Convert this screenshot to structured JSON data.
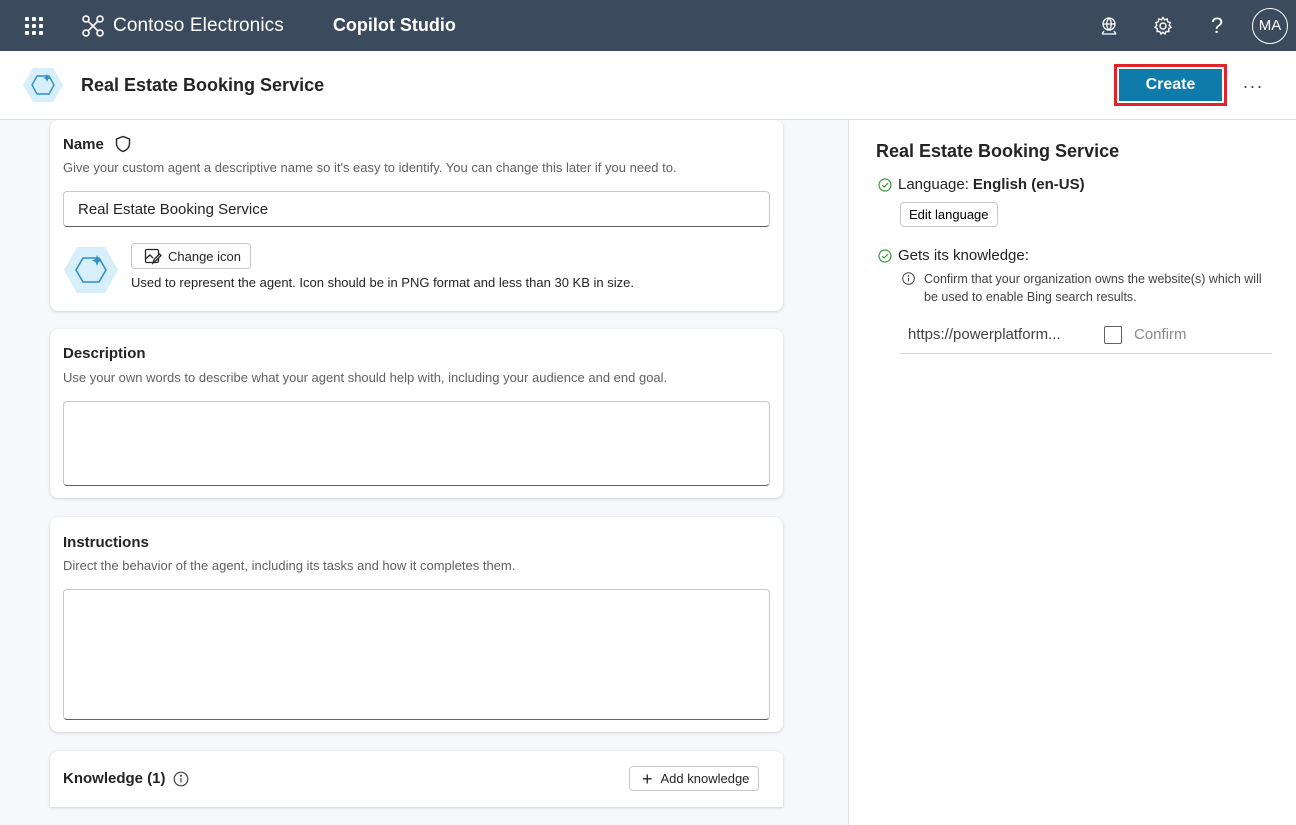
{
  "topbar": {
    "org_name": "Contoso Electronics",
    "product_name": "Copilot Studio",
    "avatar_initials": "MA",
    "help_glyph": "?"
  },
  "header": {
    "agent_name": "Real Estate Booking Service",
    "create_label": "Create",
    "more_label": "···"
  },
  "name_card": {
    "title": "Name",
    "subtitle": "Give your custom agent a descriptive name so it's easy to identify. You can change this later if you need to.",
    "value": "Real Estate Booking Service",
    "change_icon_label": "Change icon",
    "icon_note": "Used to represent the agent. Icon should be in PNG format and less than 30 KB in size."
  },
  "description_card": {
    "title": "Description",
    "subtitle": "Use your own words to describe what your agent should help with, including your audience and end goal.",
    "value": ""
  },
  "instructions_card": {
    "title": "Instructions",
    "subtitle": "Direct the behavior of the agent, including its tasks and how it completes them.",
    "value": ""
  },
  "knowledge_card": {
    "title": "Knowledge (1)",
    "add_label": "Add knowledge"
  },
  "right_panel": {
    "title": "Real Estate Booking Service",
    "language_label": "Language:",
    "language_value": "English (en-US)",
    "edit_language_label": "Edit language",
    "knowledge_label": "Gets its knowledge:",
    "confirm_note": "Confirm that your organization owns the website(s) which will be used to enable Bing search results.",
    "url": "https://powerplatform...",
    "confirm_label": "Confirm"
  },
  "colors": {
    "topbar_bg": "#3b4a5c",
    "create_button": "#0f7bab",
    "highlight_outline": "#e0242b",
    "success_check": "#3a9a3a"
  }
}
